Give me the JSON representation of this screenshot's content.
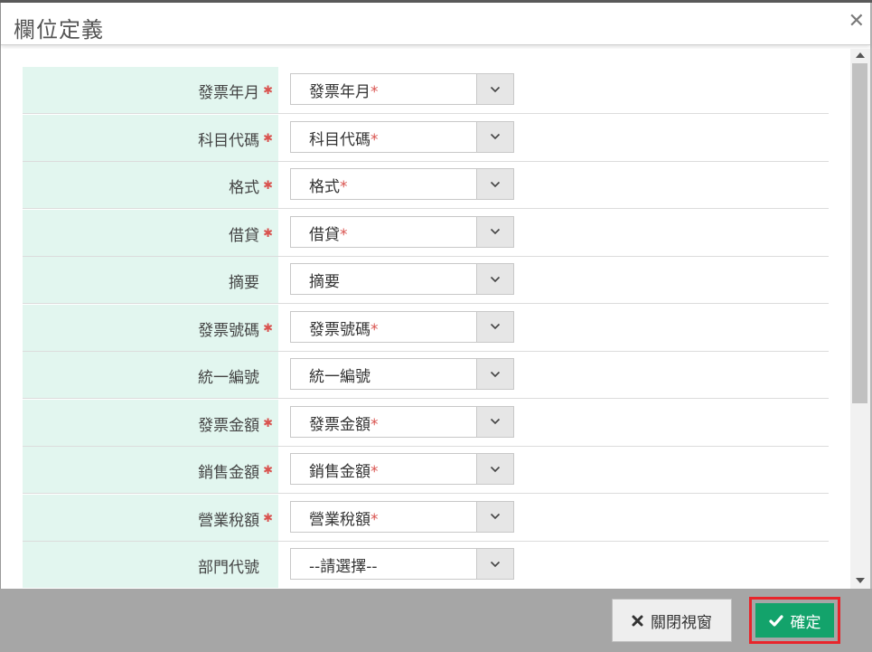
{
  "dialog": {
    "title": "欄位定義",
    "close_icon": "close-icon",
    "required_mark": "*"
  },
  "fields": [
    {
      "label": "發票年月",
      "required": true,
      "value": "發票年月",
      "value_required": true
    },
    {
      "label": "科目代碼",
      "required": true,
      "value": "科目代碼",
      "value_required": true
    },
    {
      "label": "格式",
      "required": true,
      "value": "格式",
      "value_required": true
    },
    {
      "label": "借貸",
      "required": true,
      "value": "借貸",
      "value_required": true
    },
    {
      "label": "摘要",
      "required": false,
      "value": "摘要",
      "value_required": false
    },
    {
      "label": "發票號碼",
      "required": true,
      "value": "發票號碼",
      "value_required": true
    },
    {
      "label": "統一編號",
      "required": false,
      "value": "統一編號",
      "value_required": false
    },
    {
      "label": "發票金額",
      "required": true,
      "value": "發票金額",
      "value_required": true
    },
    {
      "label": "銷售金額",
      "required": true,
      "value": "銷售金額",
      "value_required": true
    },
    {
      "label": "營業稅額",
      "required": true,
      "value": "營業稅額",
      "value_required": true
    },
    {
      "label": "部門代號",
      "required": false,
      "value": "--請選擇--",
      "value_required": false
    }
  ],
  "footer": {
    "close_label": "關閉視窗",
    "confirm_label": "確定"
  },
  "colors": {
    "label_bg": "#e2f6ef",
    "required": "#d9534f",
    "confirm": "#13a36b",
    "confirm_outline": "#e8252b",
    "footer_bg": "#a6a6a6"
  }
}
